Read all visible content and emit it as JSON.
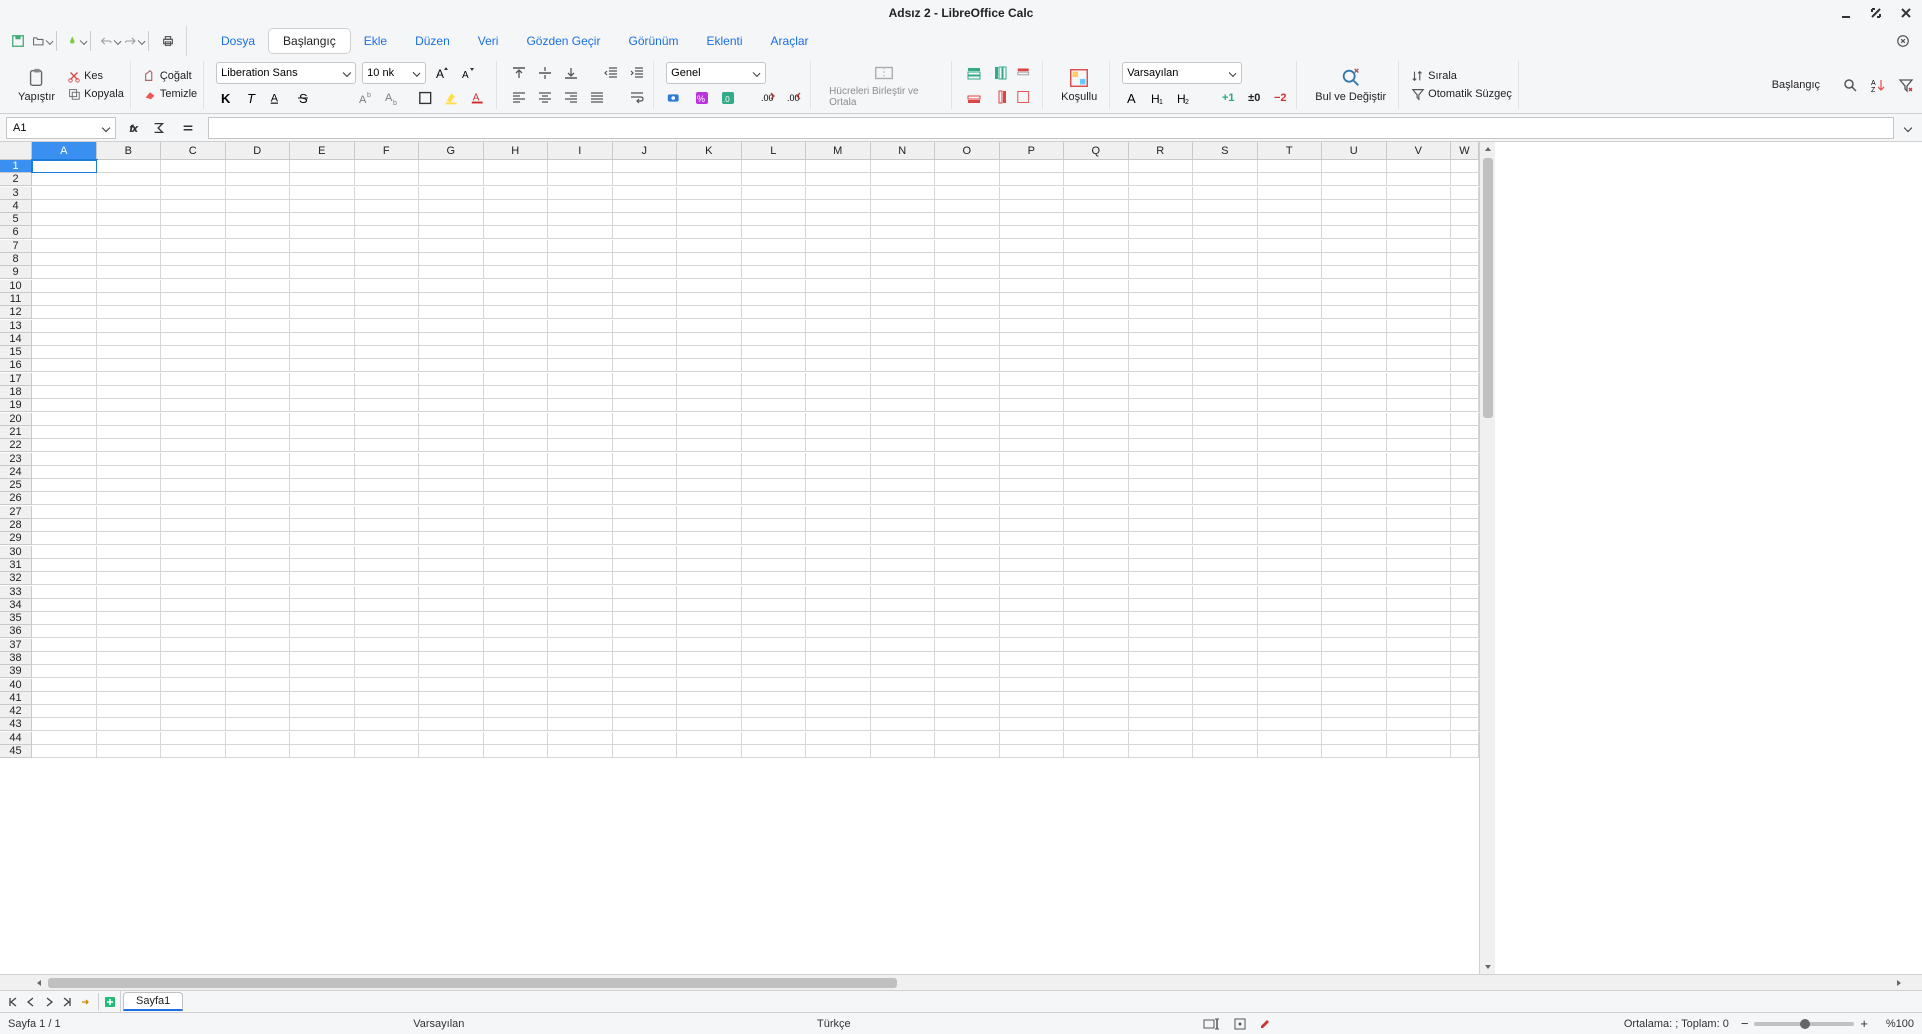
{
  "title": "Adsız 2 - LibreOffice Calc",
  "menu": {
    "items": [
      "Dosya",
      "Başlangıç",
      "Ekle",
      "Düzen",
      "Veri",
      "Gözden Geçir",
      "Görünüm",
      "Eklenti",
      "Araçlar"
    ],
    "active": "Başlangıç"
  },
  "ribbon": {
    "paste": "Yapıştır",
    "cut": "Kes",
    "copy": "Kopyala",
    "duplicate": "Çoğalt",
    "clear": "Temizle",
    "font_name": "Liberation Sans",
    "font_size": "10 nk",
    "number_format": "Genel",
    "merge": "Hücreleri Birleştir ve Ortala",
    "conditional": "Koşullu",
    "style": "Varsayılan",
    "plus_one": "+1",
    "plus_zero": "±0",
    "minus_two": "−2",
    "find_replace": "Bul ve Değiştir",
    "sort": "Sırala",
    "autofilter": "Otomatik Süzgeç",
    "home_label": "Başlangıç"
  },
  "formula_bar": {
    "cell_ref": "A1"
  },
  "grid": {
    "columns": [
      "A",
      "B",
      "C",
      "D",
      "E",
      "F",
      "G",
      "H",
      "I",
      "J",
      "K",
      "L",
      "M",
      "N",
      "O",
      "P",
      "Q",
      "R",
      "S",
      "T",
      "U",
      "V",
      "W"
    ],
    "row_count": 45,
    "selected_col": "A",
    "selected_row": 1
  },
  "sheets": {
    "active": "Sayfa1"
  },
  "status": {
    "page": "Sayfa 1 / 1",
    "style": "Varsayılan",
    "language": "Türkçe",
    "summary": "Ortalama: ; Toplam: 0",
    "zoom": "%100"
  }
}
